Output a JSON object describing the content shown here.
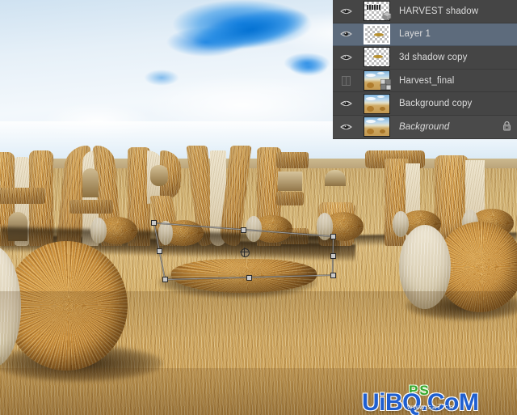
{
  "app": {
    "title": "Photoshop layers panel over harvest composite"
  },
  "layers_panel": {
    "name": "Layers",
    "rows": [
      {
        "name": "HARVEST shadow",
        "visible": true,
        "selected": false,
        "locked": false,
        "italic": false,
        "thumb_type": "transparent-text",
        "badge": "3d-badge",
        "eye_icon": "eye-icon"
      },
      {
        "name": "Layer 1",
        "visible": true,
        "selected": true,
        "locked": false,
        "italic": false,
        "thumb_type": "transparent-blob",
        "badge": "",
        "eye_icon": "eye-icon"
      },
      {
        "name": "3d shadow copy",
        "visible": true,
        "selected": false,
        "locked": false,
        "italic": false,
        "thumb_type": "transparent-blob",
        "badge": "",
        "eye_icon": "eye-icon"
      },
      {
        "name": "Harvest_final",
        "visible": false,
        "selected": false,
        "locked": false,
        "italic": false,
        "thumb_type": "photo",
        "badge": "smart-object-badge",
        "eye_icon": "eye-hidden-icon"
      },
      {
        "name": "Background copy",
        "visible": true,
        "selected": false,
        "locked": false,
        "italic": false,
        "thumb_type": "photo",
        "badge": "",
        "eye_icon": "eye-icon"
      },
      {
        "name": "Background",
        "visible": true,
        "selected": false,
        "locked": true,
        "italic": true,
        "thumb_type": "photo",
        "badge": "",
        "eye_icon": "eye-icon"
      }
    ]
  },
  "canvas": {
    "headline_text": "HARVEST",
    "scene_description": "Round hay bales in a stubble field under a blue cloudy sky",
    "transform": {
      "active": true,
      "handle_count": 8,
      "has_center_point": true
    }
  },
  "watermark": {
    "main": "UiBQ.CoM",
    "sub": "www.sa7.cn",
    "cn": "PS",
    "color_main": "#1f5fd0",
    "color_cn": "#35a62c"
  },
  "colors": {
    "panel_bg": "#454545",
    "panel_row_selected": "#5d6b7c",
    "panel_text": "#dcdcdc",
    "sky_blue": "#0a78dc",
    "hay_gold": "#c98f3c",
    "field_gold": "#cfa962"
  }
}
